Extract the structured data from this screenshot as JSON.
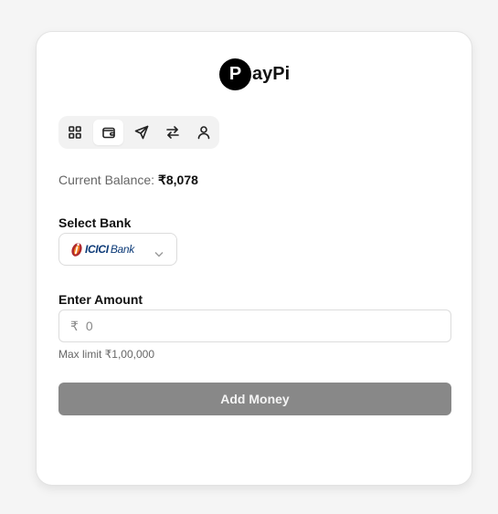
{
  "logo": {
    "letter": "P",
    "text": "ayPi"
  },
  "tabs": [
    {
      "name": "dashboard",
      "icon": "grid-icon",
      "active": false
    },
    {
      "name": "wallet",
      "icon": "wallet-icon",
      "active": true
    },
    {
      "name": "send",
      "icon": "send-icon",
      "active": false
    },
    {
      "name": "transfer",
      "icon": "arrows-exchange-icon",
      "active": false
    },
    {
      "name": "profile",
      "icon": "user-icon",
      "active": false
    }
  ],
  "balance": {
    "label": "Current Balance: ",
    "value": "₹8,078"
  },
  "bank": {
    "label": "Select Bank",
    "selected": {
      "name_bold": "ICICI",
      "name_light": "Bank"
    }
  },
  "amount": {
    "label": "Enter Amount",
    "currency": "₹",
    "placeholder": "0",
    "value": "",
    "hint": "Max limit ₹1,00,000"
  },
  "action": {
    "label": "Add Money",
    "color": "#888888"
  }
}
